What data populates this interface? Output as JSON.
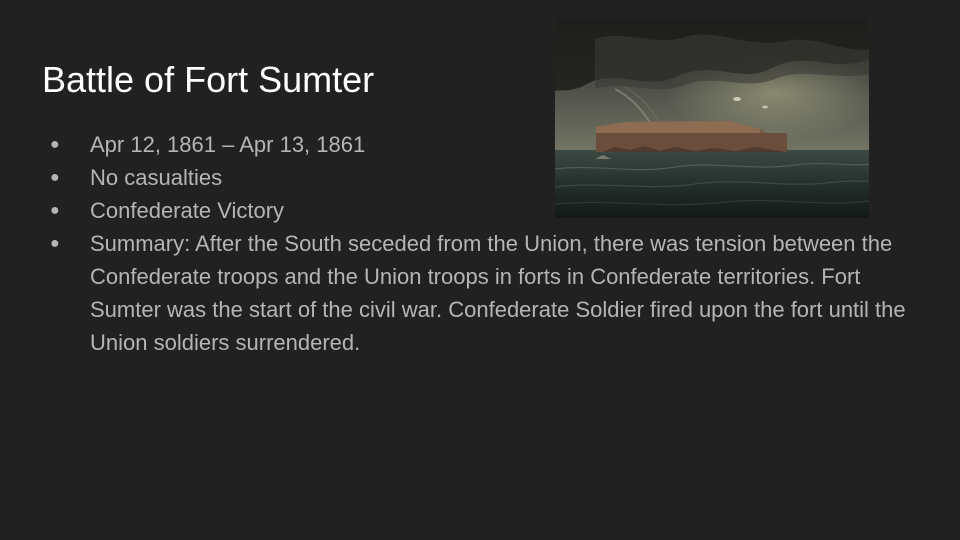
{
  "slide": {
    "title": "Battle of Fort Sumter",
    "bullets": [
      "Apr 12, 1861 – Apr 13, 1861",
      "No casualties",
      "Confederate Victory",
      "Summary: After the South seceded from the Union, there was tension between the Confederate troops and the Union troops in forts in Confederate territories. Fort Sumter was the start of the civil war. Confederate Soldier fired upon the fort until the Union soldiers surrendered."
    ],
    "bullet_glyph": "●"
  },
  "colors": {
    "background": "#212121",
    "title": "#ffffff",
    "body_text": "#b5b5b5"
  }
}
